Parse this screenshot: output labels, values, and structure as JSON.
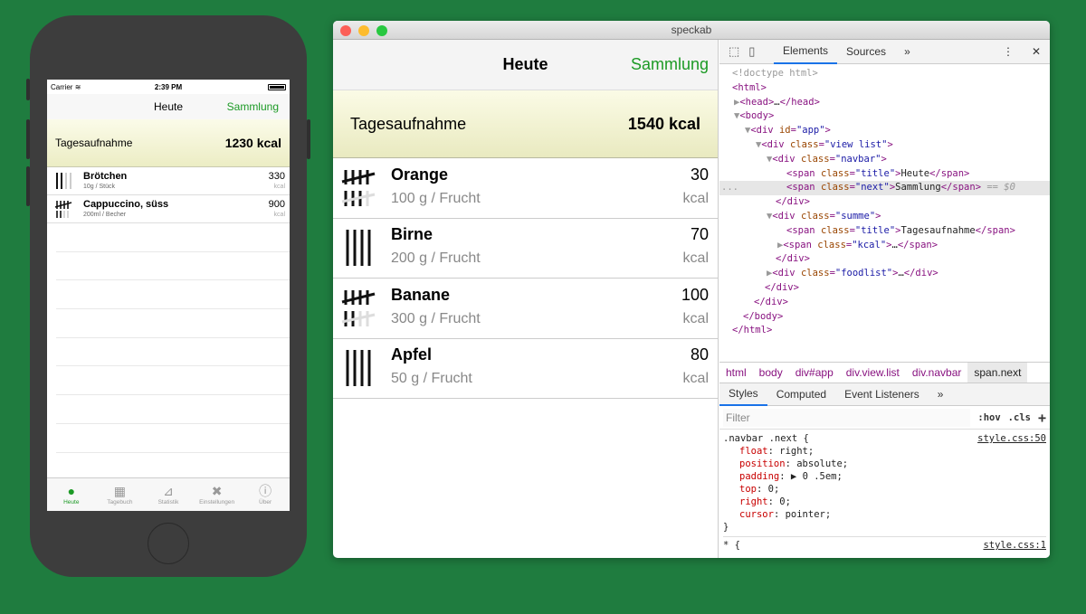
{
  "phone": {
    "status": {
      "carrier": "Carrier",
      "wifi_icon": "wifi-icon",
      "time": "2:39 PM",
      "battery_icon": "battery-icon"
    },
    "navbar": {
      "title": "Heute",
      "next": "Sammlung"
    },
    "summe": {
      "title": "Tagesaufnahme",
      "kcal": "1230 kcal"
    },
    "items": [
      {
        "name": "Brötchen",
        "desc": "10g / Stück",
        "value": "330",
        "unit": "kcal"
      },
      {
        "name": "Cappuccino, süss",
        "desc": "200ml / Becher",
        "value": "900",
        "unit": "kcal"
      }
    ],
    "tabs": [
      {
        "label": "Heute",
        "icon": "clock-icon"
      },
      {
        "label": "Tagebuch",
        "icon": "calendar-icon"
      },
      {
        "label": "Statistik",
        "icon": "chart-icon"
      },
      {
        "label": "Einstellungen",
        "icon": "tools-icon"
      },
      {
        "label": "Über",
        "icon": "info-icon"
      }
    ]
  },
  "window": {
    "title": "speckab",
    "colors": {
      "close": "#fc5f57",
      "minimize": "#fdbc2e",
      "zoom": "#28c840"
    }
  },
  "app": {
    "navbar": {
      "title": "Heute",
      "next": "Sammlung"
    },
    "summe": {
      "title": "Tagesaufnahme",
      "kcal": "1540 kcal"
    },
    "items": [
      {
        "name": "Orange",
        "desc": "100 g / Frucht",
        "value": "30",
        "unit": "kcal"
      },
      {
        "name": "Birne",
        "desc": "200 g / Frucht",
        "value": "70",
        "unit": "kcal"
      },
      {
        "name": "Banane",
        "desc": "300 g / Frucht",
        "value": "100",
        "unit": "kcal"
      },
      {
        "name": "Apfel",
        "desc": "50 g / Frucht",
        "value": "80",
        "unit": "kcal"
      }
    ]
  },
  "devtools": {
    "tabs": {
      "elements": "Elements",
      "sources": "Sources",
      "more": "»"
    },
    "dom": {
      "doctype": "<!doctype html>",
      "html": "html",
      "head": "head",
      "body": "body",
      "div": "div",
      "span": "span",
      "id_attr": "id",
      "class_attr": "class",
      "app_id": "\"app\"",
      "view_list": "\"view list\"",
      "navbar": "\"navbar\"",
      "title_cls": "\"title\"",
      "heute": "Heute",
      "next_cls": "\"next\"",
      "sammlung": "Sammlung",
      "sel_marker": "== $0",
      "summe": "\"summe\"",
      "tagesaufnahme": "Tagesaufnahme",
      "kcal_cls": "\"kcal\"",
      "foodlist": "\"foodlist\"",
      "ellipsis": "…",
      "dots": "..."
    },
    "breadcrumbs": [
      "html",
      "body",
      "div#app",
      "div.view.list",
      "div.navbar",
      "span.next"
    ],
    "styles_tabs": {
      "styles": "Styles",
      "computed": "Computed",
      "listeners": "Event Listeners",
      "more": "»"
    },
    "filter": {
      "placeholder": "Filter",
      "hov": ":hov",
      "cls": ".cls",
      "add": "+"
    },
    "rule1": {
      "selector": ".navbar .next {",
      "source": "style.css:50",
      "props": [
        {
          "name": "float",
          "value": "right;"
        },
        {
          "name": "position",
          "value": "absolute;"
        },
        {
          "name": "padding",
          "value": "▶ 0 .5em;"
        },
        {
          "name": "top",
          "value": "0;"
        },
        {
          "name": "right",
          "value": "0;"
        },
        {
          "name": "cursor",
          "value": "pointer;"
        }
      ],
      "close": "}"
    },
    "rule2": {
      "selector": "* {",
      "source": "style.css:1"
    }
  }
}
